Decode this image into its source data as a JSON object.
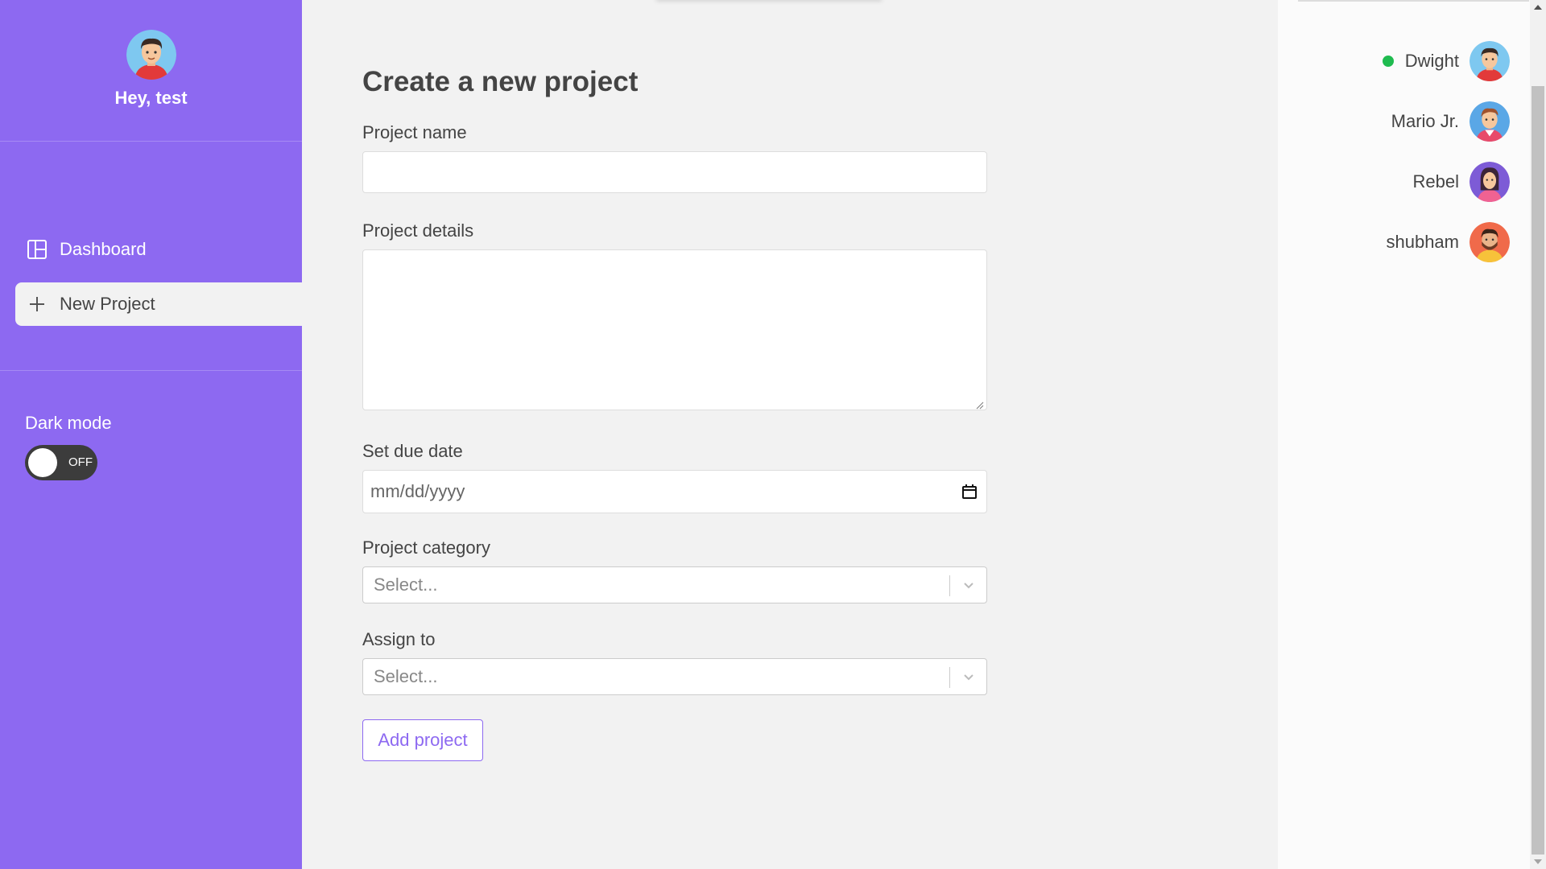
{
  "sidebar": {
    "greeting": "Hey, test",
    "nav": [
      {
        "label": "Dashboard",
        "icon": "dashboard-icon",
        "active": false
      },
      {
        "label": "New Project",
        "icon": "add-icon",
        "active": true
      }
    ],
    "dark_mode": {
      "label": "Dark mode",
      "state": "OFF"
    }
  },
  "main": {
    "title": "Create a new project",
    "fields": {
      "name_label": "Project name",
      "name_value": "",
      "details_label": "Project details",
      "details_value": "",
      "due_label": "Set due date",
      "due_placeholder": "mm/dd/yyyy",
      "category_label": "Project category",
      "category_placeholder": "Select...",
      "assign_label": "Assign to",
      "assign_placeholder": "Select..."
    },
    "submit_label": "Add project"
  },
  "online_users": [
    {
      "name": "Dwight",
      "online": true
    },
    {
      "name": "Mario Jr.",
      "online": false
    },
    {
      "name": "Rebel",
      "online": false
    },
    {
      "name": "shubham",
      "online": false
    }
  ],
  "colors": {
    "sidebar": "#8d69f1",
    "accent": "#8d69f1",
    "online_dot": "#1fbb4f",
    "page_bg": "#f2f2f2"
  }
}
